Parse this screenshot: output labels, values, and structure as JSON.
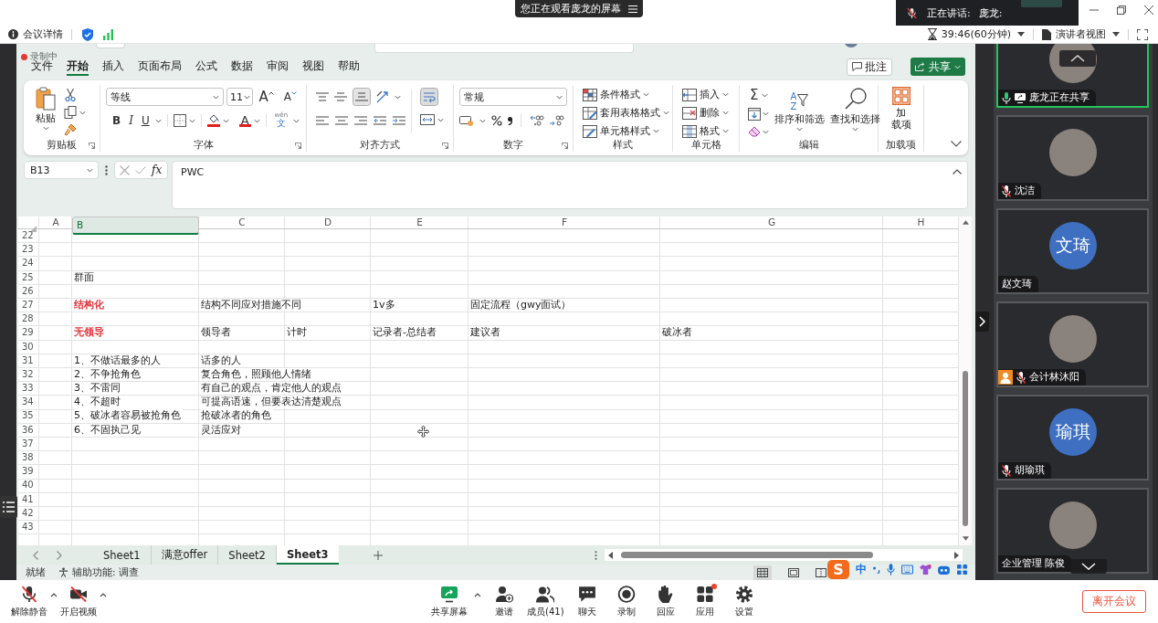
{
  "top_bar": {
    "notice": "您正在观看庞龙的屏幕",
    "speaking_label": "正在讲话:",
    "speaker": "庞龙:"
  },
  "meeting_bar": {
    "details": "会议详情",
    "timer": "39:46(60分钟)",
    "view": "演讲者视图"
  },
  "excel": {
    "recording": "录制中",
    "menu_tabs": [
      {
        "label": "文件",
        "selected": false
      },
      {
        "label": "开始",
        "selected": true
      },
      {
        "label": "插入",
        "selected": false
      },
      {
        "label": "页面布局",
        "selected": false
      },
      {
        "label": "公式",
        "selected": false
      },
      {
        "label": "数据",
        "selected": false
      },
      {
        "label": "审阅",
        "selected": false
      },
      {
        "label": "视图",
        "selected": false
      },
      {
        "label": "帮助",
        "selected": false
      }
    ],
    "comment_button": "批注",
    "share_button": "共享",
    "ribbon": {
      "clipboard": {
        "label": "剪贴板",
        "paste": "粘贴"
      },
      "font": {
        "label": "字体",
        "font_name": "等线",
        "font_size": "11",
        "grow": "A",
        "shrink": "A",
        "bold": "B",
        "italic": "I",
        "underline": "U",
        "font_color": "A",
        "phonetic_top": "wén",
        "phonetic_char": "文"
      },
      "alignment": {
        "label": "对齐方式",
        "vertical": [
          {
            "kind": "top",
            "selected": false
          },
          {
            "kind": "middle",
            "selected": false
          },
          {
            "kind": "bottom",
            "selected": true
          }
        ],
        "wrap_text": {
          "selected": true
        }
      },
      "number": {
        "label": "数字",
        "format": "常规"
      },
      "styles": {
        "label": "样式",
        "items": [
          {
            "kind": "conditional",
            "label": "条件格式"
          },
          {
            "kind": "table",
            "label": "套用表格格式"
          },
          {
            "kind": "cell",
            "label": "单元格样式"
          }
        ]
      },
      "cells": {
        "label": "单元格",
        "items": [
          {
            "kind": "insert",
            "label": "插入"
          },
          {
            "kind": "delete",
            "label": "删除"
          },
          {
            "kind": "format",
            "label": "格式"
          }
        ]
      },
      "editing": {
        "label": "编辑",
        "autosum": "Σ",
        "sort_letters": [
          "A",
          "Z"
        ],
        "sort": "排序和筛选",
        "find": "查找和选择"
      },
      "addins": {
        "label": "加载项",
        "button_lines": [
          "加",
          "载项"
        ]
      }
    },
    "name_box": "B13",
    "fx": "fx",
    "formula": "PWC",
    "columns": [
      {
        "label": "A",
        "selected": false
      },
      {
        "label": "B",
        "selected": true
      },
      {
        "label": "C",
        "selected": false
      },
      {
        "label": "D",
        "selected": false
      },
      {
        "label": "E",
        "selected": false
      },
      {
        "label": "F",
        "selected": false
      },
      {
        "label": "G",
        "selected": false
      },
      {
        "label": "H",
        "selected": false
      }
    ],
    "rows": [
      {
        "number": "22"
      },
      {
        "number": "23"
      },
      {
        "number": "24"
      },
      {
        "number": "25",
        "cells": [
          null,
          {
            "text": "群面"
          }
        ]
      },
      {
        "number": "26"
      },
      {
        "number": "27",
        "cells": [
          null,
          {
            "text": "结构化",
            "color": "#e0383e"
          },
          {
            "text": "结构不同应对措施不同"
          },
          null,
          {
            "text": "1v多"
          },
          {
            "text": "固定流程（gwy面试）"
          }
        ]
      },
      {
        "number": "28"
      },
      {
        "number": "29",
        "cells": [
          null,
          {
            "text": "无领导",
            "color": "#e0383e"
          },
          {
            "text": "领导者"
          },
          {
            "text": "计时"
          },
          {
            "text": "记录者-总结者"
          },
          {
            "text": "建议者"
          },
          {
            "text": "破冰者"
          }
        ]
      },
      {
        "number": "30"
      },
      {
        "number": "31",
        "cells": [
          null,
          {
            "text": "1、不做话最多的人"
          },
          {
            "text": "话多的人"
          }
        ]
      },
      {
        "number": "32",
        "cells": [
          null,
          {
            "text": "2、不争抢角色"
          },
          {
            "text": "复合角色，照顾他人情绪"
          }
        ]
      },
      {
        "number": "33",
        "cells": [
          null,
          {
            "text": "3、不雷同"
          },
          {
            "text": "有自己的观点，肯定他人的观点"
          }
        ]
      },
      {
        "number": "34",
        "cells": [
          null,
          {
            "text": "4、不超时"
          },
          {
            "text": "可提高语速，但要表达清楚观点"
          }
        ]
      },
      {
        "number": "35",
        "cells": [
          null,
          {
            "text": "5、破冰者容易被抢角色"
          },
          {
            "text": "抢破冰者的角色"
          }
        ]
      },
      {
        "number": "36",
        "cells": [
          null,
          {
            "text": "6、不固执己见"
          },
          {
            "text": "灵活应对"
          }
        ]
      },
      {
        "number": "37"
      },
      {
        "number": "38"
      },
      {
        "number": "39"
      },
      {
        "number": "40"
      },
      {
        "number": "41"
      },
      {
        "number": "42"
      },
      {
        "number": "43"
      }
    ],
    "sheet_tabs": [
      {
        "label": "Sheet1",
        "selected": false
      },
      {
        "label": "满意offer",
        "selected": false
      },
      {
        "label": "Sheet2",
        "selected": false
      },
      {
        "label": "Sheet3",
        "selected": true
      }
    ],
    "status": {
      "ready": "就绪",
      "accessibility": "辅助功能: 调查",
      "views": [
        {
          "kind": "normal",
          "selected": true
        },
        {
          "kind": "page_layout",
          "selected": false
        },
        {
          "kind": "page_break",
          "selected": false
        }
      ]
    },
    "ime": {
      "logo": "S",
      "mode": "中"
    }
  },
  "participants": [
    {
      "name": "庞龙正在共享",
      "avatar": {
        "kind": "photo"
      },
      "speaking": true,
      "muted": false,
      "sharing": true,
      "highlighted": true,
      "host": false
    },
    {
      "name": "沈洁",
      "avatar": {
        "kind": "photo"
      },
      "speaking": false,
      "muted": true,
      "sharing": false,
      "highlighted": false,
      "host": false
    },
    {
      "name": "赵文琦",
      "avatar": {
        "kind": "initials",
        "text": "文琦"
      },
      "speaking": false,
      "muted": false,
      "sharing": false,
      "highlighted": false,
      "host": false
    },
    {
      "name": "会计林沐阳",
      "avatar": {
        "kind": "photo"
      },
      "speaking": false,
      "muted": true,
      "sharing": false,
      "highlighted": false,
      "host": true
    },
    {
      "name": "胡瑜琪",
      "avatar": {
        "kind": "initials",
        "text": "瑜琪"
      },
      "speaking": false,
      "muted": true,
      "sharing": false,
      "highlighted": false,
      "host": false
    },
    {
      "name": "企业管理 陈俊",
      "avatar": {
        "kind": "photo"
      },
      "speaking": false,
      "muted": false,
      "sharing": false,
      "highlighted": false,
      "host": false
    }
  ],
  "toolbar": {
    "left": [
      {
        "kind": "mic",
        "label": "解除静音",
        "menu": true
      },
      {
        "kind": "camera",
        "label": "开启视频",
        "menu": true
      }
    ],
    "center": [
      {
        "kind": "share",
        "label": "共享屏幕",
        "menu": true,
        "dot": false
      },
      {
        "kind": "invite",
        "label": "邀请",
        "menu": false,
        "dot": false
      },
      {
        "kind": "members",
        "label": "成员(41)",
        "menu": false,
        "dot": false
      },
      {
        "kind": "chat",
        "label": "聊天",
        "menu": false,
        "dot": false
      },
      {
        "kind": "record",
        "label": "录制",
        "menu": false,
        "dot": false
      },
      {
        "kind": "react",
        "label": "回应",
        "menu": false,
        "dot": false
      },
      {
        "kind": "apps",
        "label": "应用",
        "menu": false,
        "dot": true
      },
      {
        "kind": "settings",
        "label": "设置",
        "menu": false,
        "dot": false
      }
    ],
    "leave": "离开会议"
  }
}
